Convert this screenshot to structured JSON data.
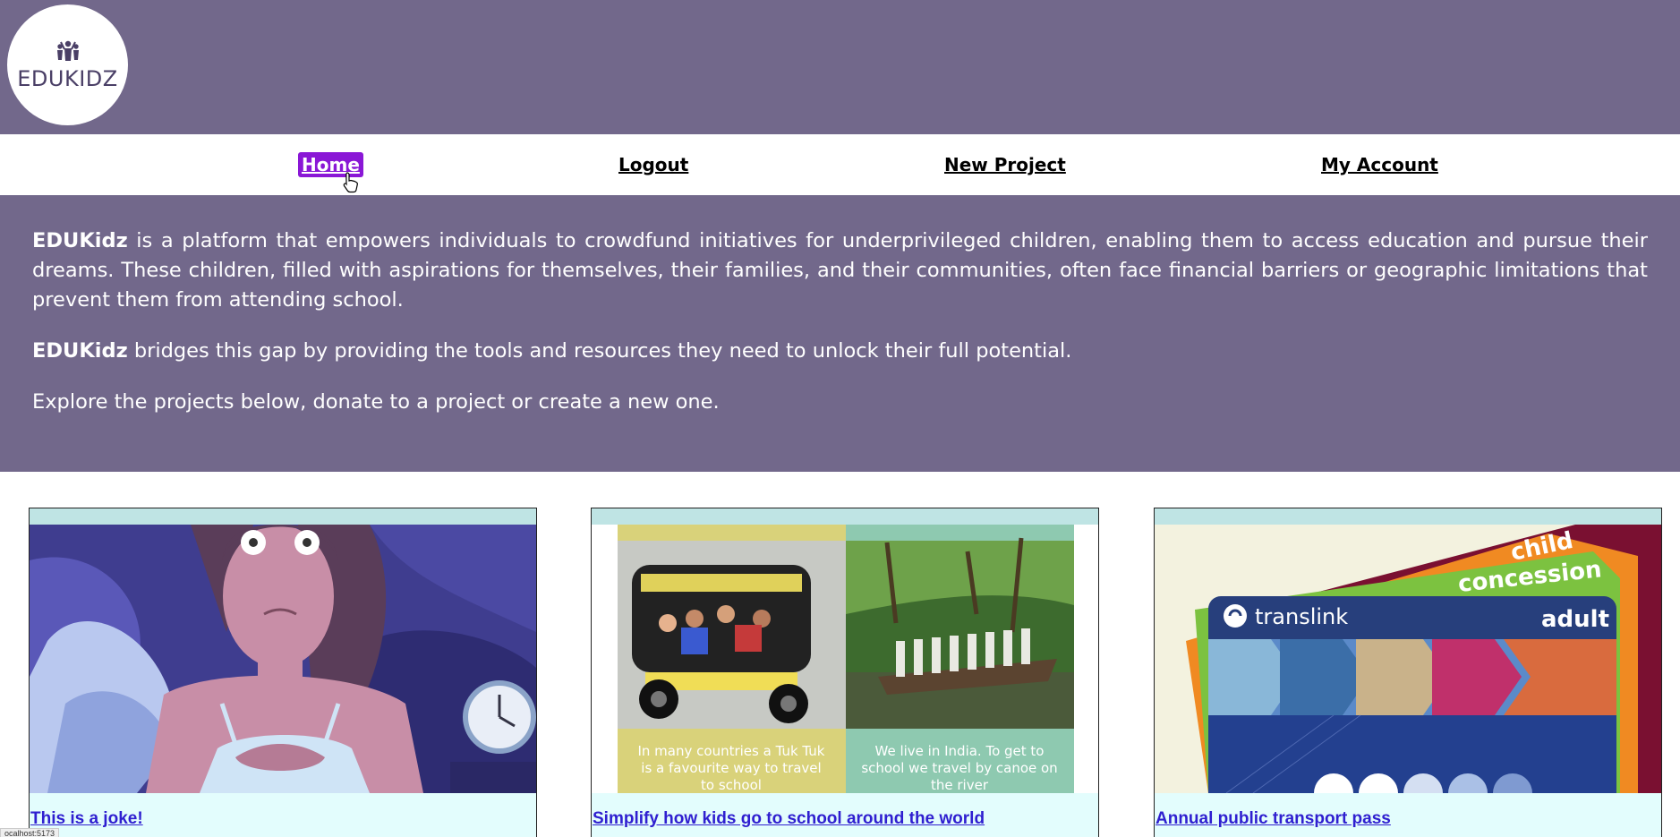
{
  "logo": {
    "text": "EDUKIDZ"
  },
  "nav": {
    "items": [
      {
        "label": "Home",
        "active": true
      },
      {
        "label": "Logout",
        "active": false
      },
      {
        "label": "New Project",
        "active": false
      },
      {
        "label": "My Account",
        "active": false
      }
    ]
  },
  "intro": {
    "p1_brand": "EDUKidz",
    "p1_text": " is a platform that empowers individuals to crowdfund initiatives for underprivileged children, enabling them to access education and pursue their dreams. These children, filled with aspirations for themselves, their families, and their communities, often face financial barriers or geographic limitations that prevent them from attending school.",
    "p2_brand": "EDUKidz",
    "p2_text": " bridges this gap by providing the tools and resources they need to unlock their full potential.",
    "p3_text": "Explore the projects below, donate to a project or create a new one."
  },
  "projects": [
    {
      "title": "This is a joke!"
    },
    {
      "title": "Simplify how kids go to school around the world",
      "caption_left": "In many countries a Tuk Tuk is a favourite way to travel to school",
      "caption_right": "We live in India. To get to school we travel by canoe on the river"
    },
    {
      "title": "Annual public transport pass",
      "brand": "translink",
      "labels": [
        "child",
        "concession",
        "adult"
      ]
    }
  ],
  "status_bar": {
    "text": "ocalhost:5173"
  },
  "colors": {
    "header_bg": "#72688b",
    "active_nav": "#8a17d6",
    "card_bg": "#e3fdfd",
    "link": "#2f1fd0"
  }
}
